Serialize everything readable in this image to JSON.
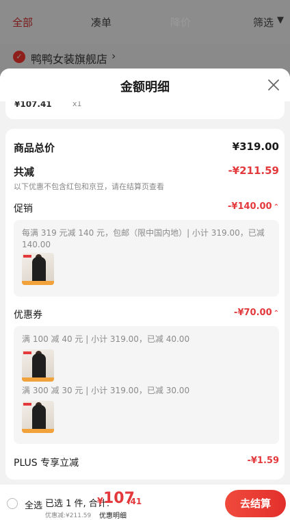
{
  "background": {
    "tabs": [
      "全部",
      "凑单",
      "降价"
    ],
    "filter_label": "筛选",
    "store_name": "鸭鸭女装旗舰店"
  },
  "sheet": {
    "title": "金额明细",
    "peek_item": {
      "price": "¥107.41",
      "qty": "x1"
    },
    "goods_total": {
      "label": "商品总价",
      "value": "¥319.00"
    },
    "total_reduction": {
      "label": "共减",
      "value": "-¥211.59",
      "note": "以下优惠不包含红包和京豆，请在结算页查看"
    },
    "promotion": {
      "label": "促销",
      "value": "-¥140.00",
      "rule_line1": "每满 319 元减 140 元，包邮（限中国内地）| 小计 319.00，已减",
      "rule_line2": "140.00"
    },
    "coupon": {
      "label": "优惠券",
      "value": "-¥70.00",
      "rule1": "满 100 减 40 元 | 小计 319.00，已减 40.00",
      "rule2": "满 300 减 30 元 | 小计 319.00，已减 30.00"
    },
    "plus": {
      "label": "PLUS 专享立减",
      "value": "-¥1.59"
    }
  },
  "bottom_bar": {
    "select_all": "全选",
    "selected_info": "已选 1 件, 合计:",
    "currency": "¥",
    "total_int": "107",
    "total_dec": ".41",
    "discount_note": "优惠减:¥211.59",
    "detail_link": "优惠明细",
    "checkout": "去结算"
  },
  "colors": {
    "accent": "#e4393c",
    "overlay": "#8a8a8a"
  }
}
